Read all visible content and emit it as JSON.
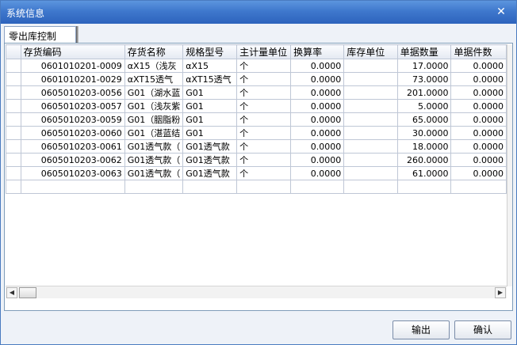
{
  "window": {
    "title": "系统信息",
    "close_glyph": "✕"
  },
  "tabs": [
    {
      "label": "零出库控制"
    }
  ],
  "table": {
    "columns": [
      "",
      "存货编码",
      "存货名称",
      "规格型号",
      "主计量单位",
      "换算率",
      "库存单位",
      "单据数量",
      "单据件数"
    ],
    "rows": [
      [
        "",
        "0601010201-0009",
        "αX15（浅灰",
        "αX15",
        "个",
        "0.0000",
        "",
        "17.0000",
        "0.0000"
      ],
      [
        "",
        "0601010201-0029",
        "αXT15透气",
        "αXT15透气",
        "个",
        "0.0000",
        "",
        "73.0000",
        "0.0000"
      ],
      [
        "",
        "0605010203-0056",
        "G01（湖水蓝",
        "G01",
        "个",
        "0.0000",
        "",
        "201.0000",
        "0.0000"
      ],
      [
        "",
        "0605010203-0057",
        "G01（浅灰紫",
        "G01",
        "个",
        "0.0000",
        "",
        "5.0000",
        "0.0000"
      ],
      [
        "",
        "0605010203-0059",
        "G01（胭脂粉",
        "G01",
        "个",
        "0.0000",
        "",
        "65.0000",
        "0.0000"
      ],
      [
        "",
        "0605010203-0060",
        "G01（湛蓝结",
        "G01",
        "个",
        "0.0000",
        "",
        "30.0000",
        "0.0000"
      ],
      [
        "",
        "0605010203-0061",
        "G01透气款（",
        "G01透气款",
        "个",
        "0.0000",
        "",
        "18.0000",
        "0.0000"
      ],
      [
        "",
        "0605010203-0062",
        "G01透气款（",
        "G01透气款",
        "个",
        "0.0000",
        "",
        "260.0000",
        "0.0000"
      ],
      [
        "",
        "0605010203-0063",
        "G01透气款（",
        "G01透气款",
        "个",
        "0.0000",
        "",
        "61.0000",
        "0.0000"
      ],
      [
        "",
        "",
        "",
        "",
        "",
        "",
        "",
        "",
        ""
      ]
    ]
  },
  "scrollbar": {
    "left_glyph": "◀",
    "right_glyph": "▶"
  },
  "buttons": {
    "export": "输出",
    "ok": "确认"
  }
}
